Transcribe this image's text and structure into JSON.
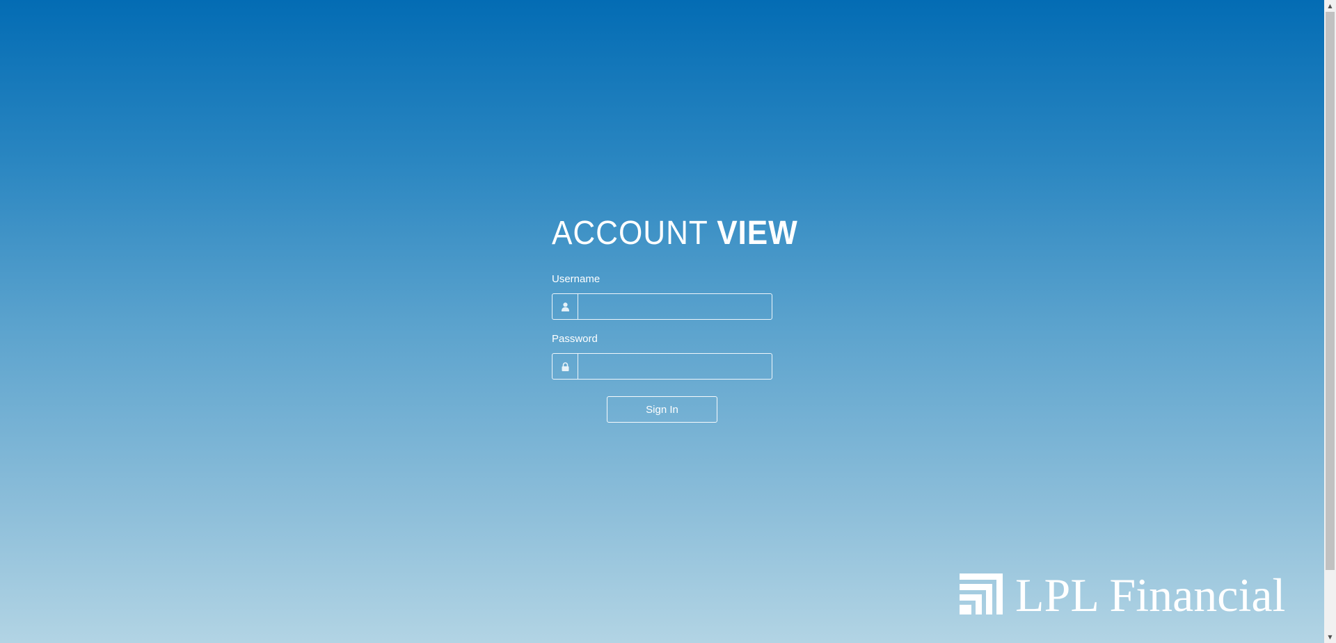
{
  "login": {
    "title_light": "ACCOUNT",
    "title_bold": "VIEW",
    "username_label": "Username",
    "username_value": "",
    "password_label": "Password",
    "password_value": "",
    "signin_label": "Sign In"
  },
  "icons": {
    "username": "user-icon",
    "password": "lock-icon"
  },
  "branding": {
    "logo_text": "LPL Financial"
  },
  "colors": {
    "gradient_top": "#036cb4",
    "gradient_bottom": "#b2d4e4",
    "foreground": "#ffffff"
  }
}
